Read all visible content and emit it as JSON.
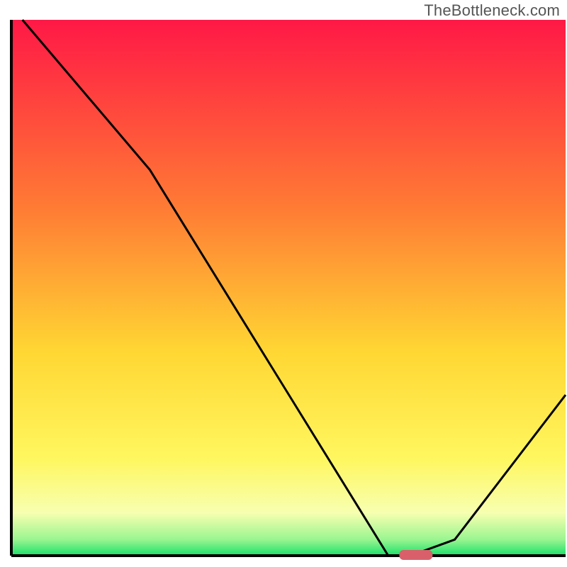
{
  "watermark": "TheBottleneck.com",
  "chart_data": {
    "type": "line",
    "title": "",
    "xlabel": "",
    "ylabel": "",
    "xlim": [
      0,
      100
    ],
    "ylim": [
      0,
      100
    ],
    "x": [
      2,
      25,
      68,
      72,
      80,
      100
    ],
    "values": [
      100,
      72,
      0,
      0,
      3,
      30
    ],
    "marker": {
      "x": 73,
      "y": 0,
      "width": 6,
      "height": 2,
      "color": "#d9606b"
    },
    "background_gradient": {
      "stops": [
        {
          "offset": 0,
          "color": "#ff1846"
        },
        {
          "offset": 35,
          "color": "#ff7b34"
        },
        {
          "offset": 62,
          "color": "#ffd733"
        },
        {
          "offset": 82,
          "color": "#fff760"
        },
        {
          "offset": 92,
          "color": "#f7ffb0"
        },
        {
          "offset": 97,
          "color": "#9af590"
        },
        {
          "offset": 100,
          "color": "#18e06a"
        }
      ]
    },
    "axis_color": "#000000",
    "line_color": "#000000"
  }
}
